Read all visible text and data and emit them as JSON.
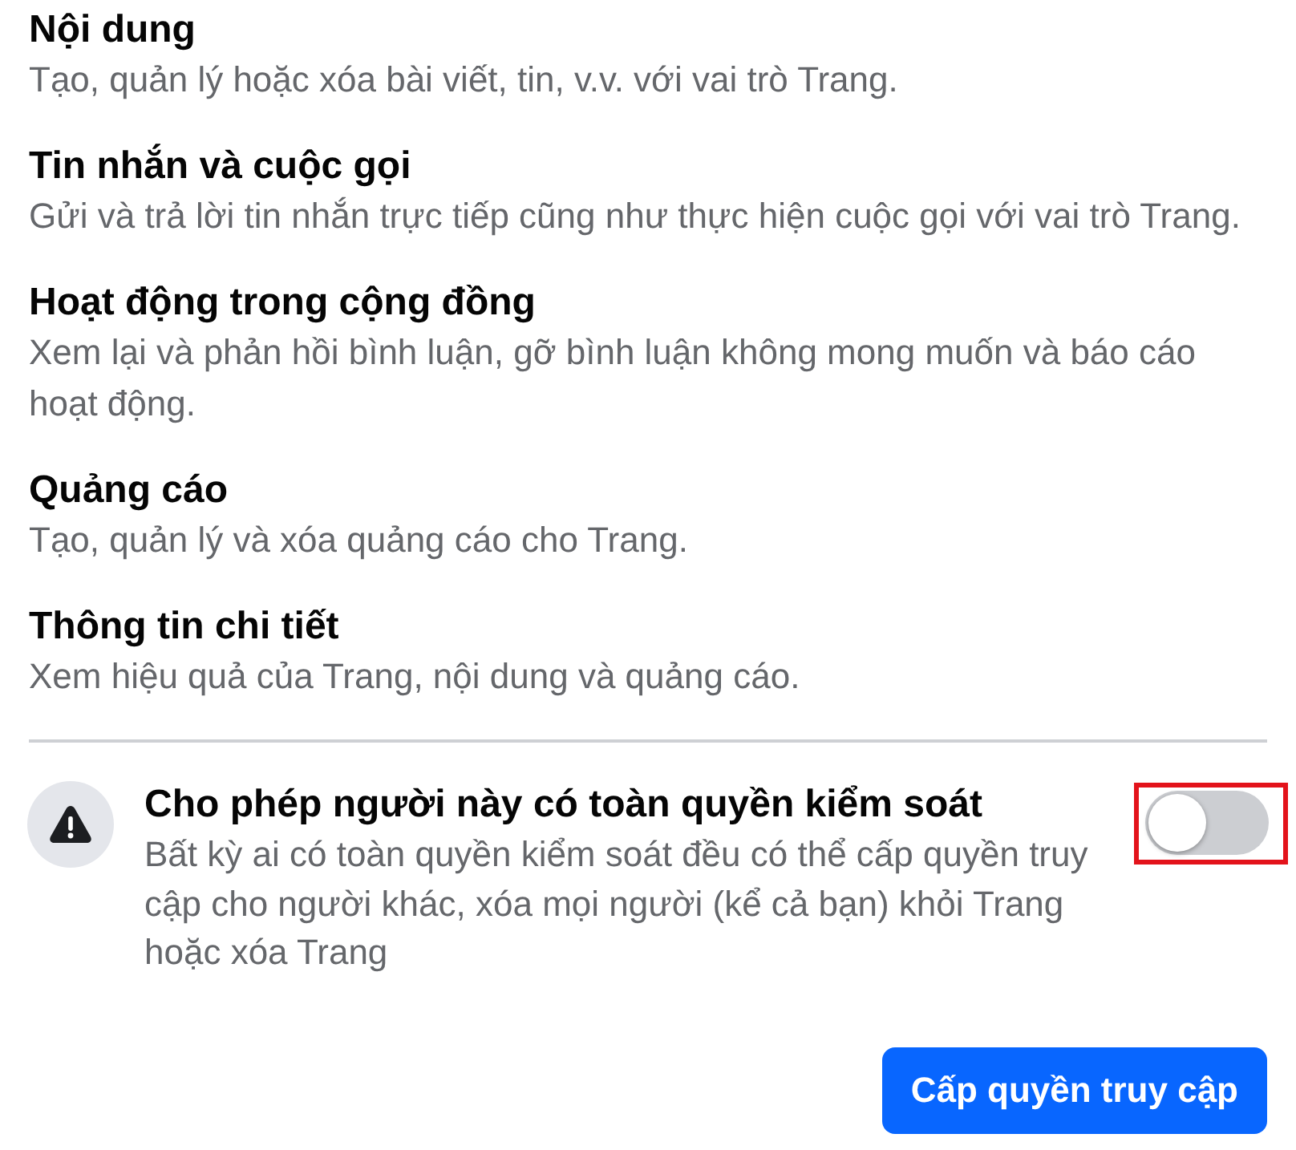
{
  "permissions": [
    {
      "title": "Nội dung",
      "description": "Tạo, quản lý hoặc xóa bài viết, tin, v.v. với vai trò Trang."
    },
    {
      "title": "Tin nhắn và cuộc gọi",
      "description": "Gửi và trả lời tin nhắn trực tiếp cũng như thực hiện cuộc gọi với vai trò Trang."
    },
    {
      "title": "Hoạt động trong cộng đồng",
      "description": "Xem lại và phản hồi bình luận, gỡ bình luận không mong muốn và báo cáo hoạt động."
    },
    {
      "title": "Quảng cáo",
      "description": "Tạo, quản lý và xóa quảng cáo cho Trang."
    },
    {
      "title": "Thông tin chi tiết",
      "description": "Xem hiệu quả của Trang, nội dung và quảng cáo."
    }
  ],
  "full_control": {
    "title": "Cho phép người này có toàn quyền kiểm soát",
    "description": "Bất kỳ ai có toàn quyền kiểm soát đều có thể cấp quyền truy cập cho người khác, xóa mọi người (kể cả bạn) khỏi Trang hoặc xóa Trang",
    "toggle": {
      "on": false,
      "highlighted": true
    }
  },
  "submit_button": {
    "label": "Cấp quyền truy cập"
  }
}
